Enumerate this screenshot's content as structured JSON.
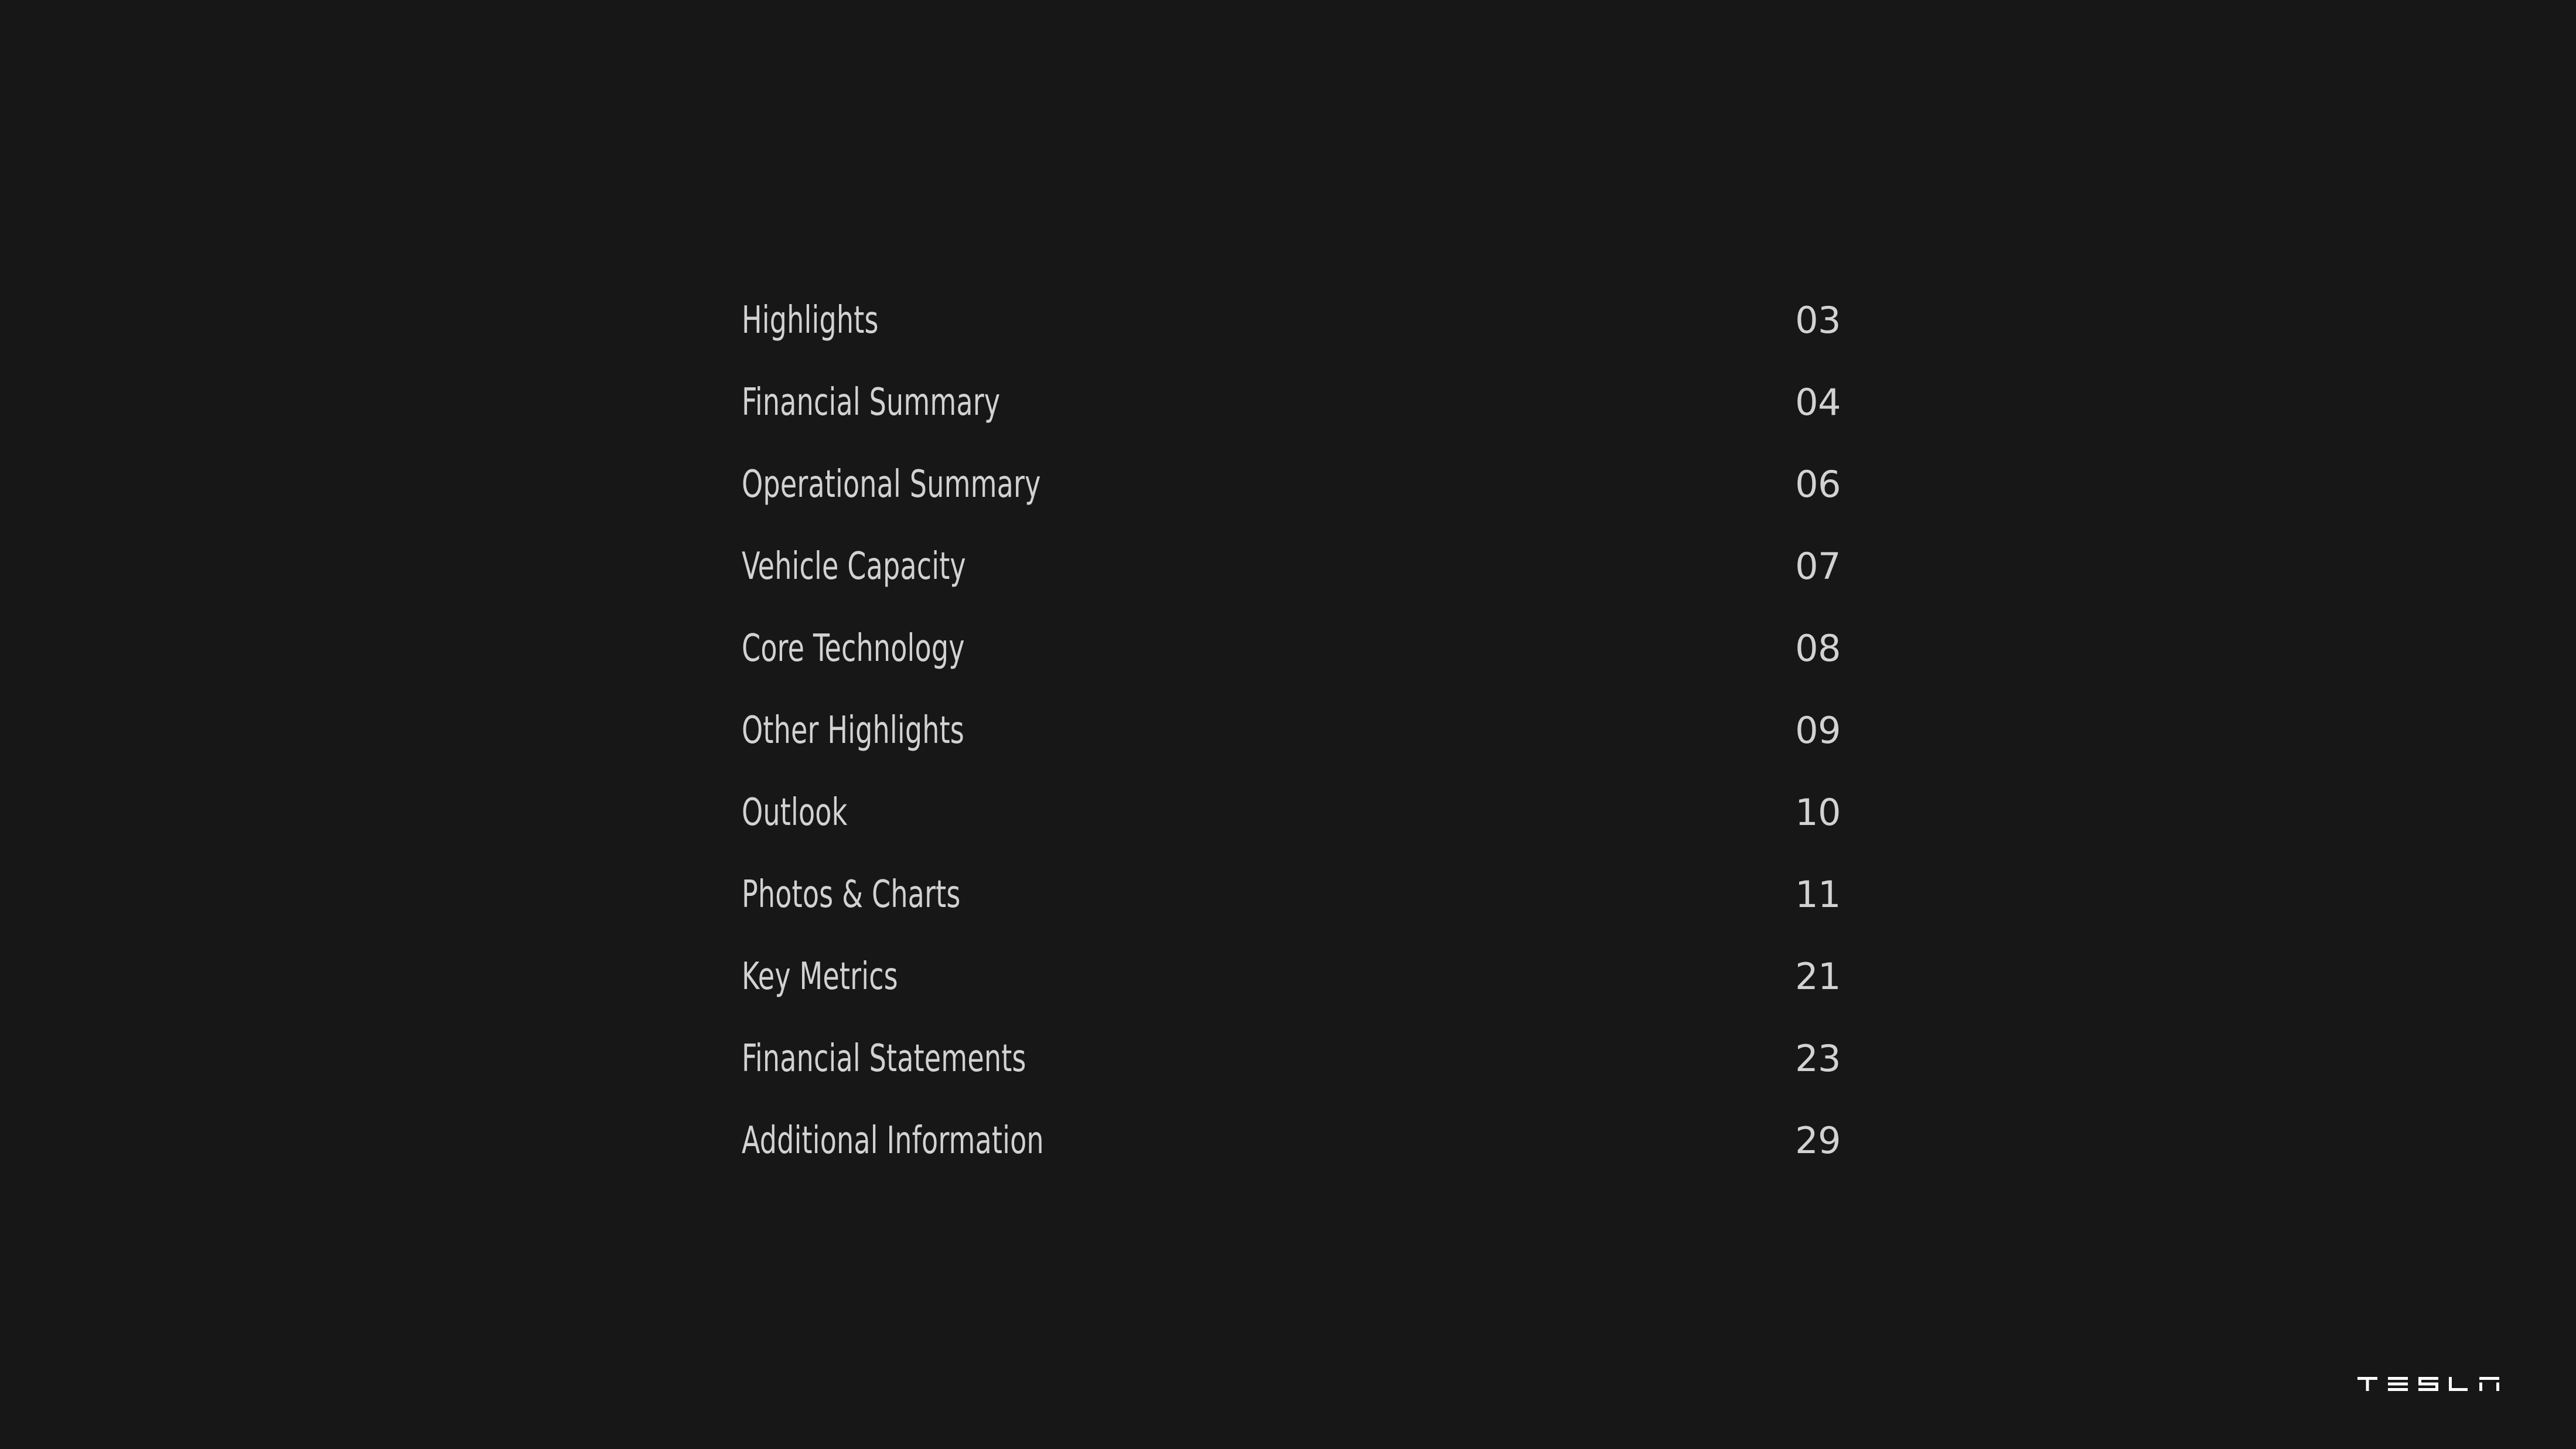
{
  "page": {
    "background_color": "#171717",
    "text_color": "#d2d2d2",
    "kind": "table-of-contents"
  },
  "toc": {
    "entries": [
      {
        "title": "Highlights",
        "page": "03"
      },
      {
        "title": "Financial Summary",
        "page": "04"
      },
      {
        "title": "Operational Summary",
        "page": "06"
      },
      {
        "title": "Vehicle Capacity",
        "page": "07"
      },
      {
        "title": "Core Technology",
        "page": "08"
      },
      {
        "title": "Other Highlights",
        "page": "09"
      },
      {
        "title": "Outlook",
        "page": "10"
      },
      {
        "title": "Photos & Charts",
        "page": "11"
      },
      {
        "title": "Key Metrics",
        "page": "21"
      },
      {
        "title": "Financial Statements",
        "page": "23"
      },
      {
        "title": "Additional Information",
        "page": "29"
      }
    ]
  },
  "branding": {
    "wordmark": "TESLA",
    "wordmark_color": "#ffffff"
  }
}
